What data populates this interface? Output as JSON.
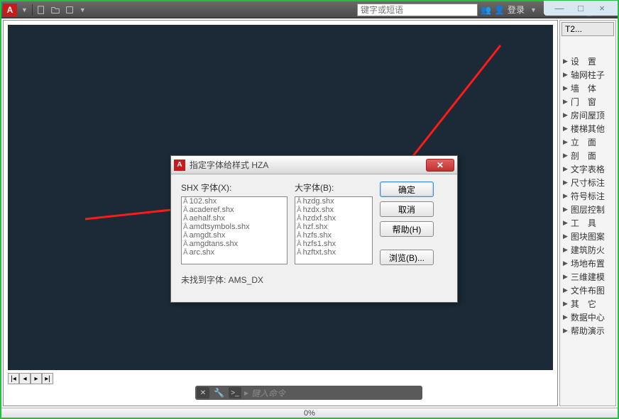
{
  "toolbar": {
    "search_placeholder": "键字或短语",
    "login_label": "登录",
    "help_icon": "?"
  },
  "side": {
    "tab": "T2...",
    "items": [
      "设　置",
      "轴网柱子",
      "墙　体",
      "门　窗",
      "房间屋顶",
      "楼梯其他",
      "立　面",
      "剖　面",
      "文字表格",
      "尺寸标注",
      "符号标注",
      "图层控制",
      "工　具",
      "图块图案",
      "建筑防火",
      "场地布置",
      "三维建模",
      "文件布图",
      "其　它",
      "数据中心",
      "帮助演示"
    ]
  },
  "cmd": {
    "placeholder": "键入命令"
  },
  "status": {
    "progress": "0%"
  },
  "dialog": {
    "title": "指定字体给样式 HZA",
    "shx_label": "SHX 字体(X):",
    "big_label": "大字体(B):",
    "ok": "确定",
    "cancel": "取消",
    "help": "帮助(H)",
    "browse": "浏览(B)...",
    "missing": "未找到字体: AMS_DX",
    "shx_list": [
      "102.shx",
      "acaderef.shx",
      "aehalf.shx",
      "amdtsymbols.shx",
      "amgdt.shx",
      "amgdtans.shx",
      "arc.shx"
    ],
    "big_list": [
      "hzdg.shx",
      "hzdx.shx",
      "hzdxf.shx",
      "hzf.shx",
      "hzfs.shx",
      "hzfs1.shx",
      "hzftxt.shx"
    ]
  }
}
